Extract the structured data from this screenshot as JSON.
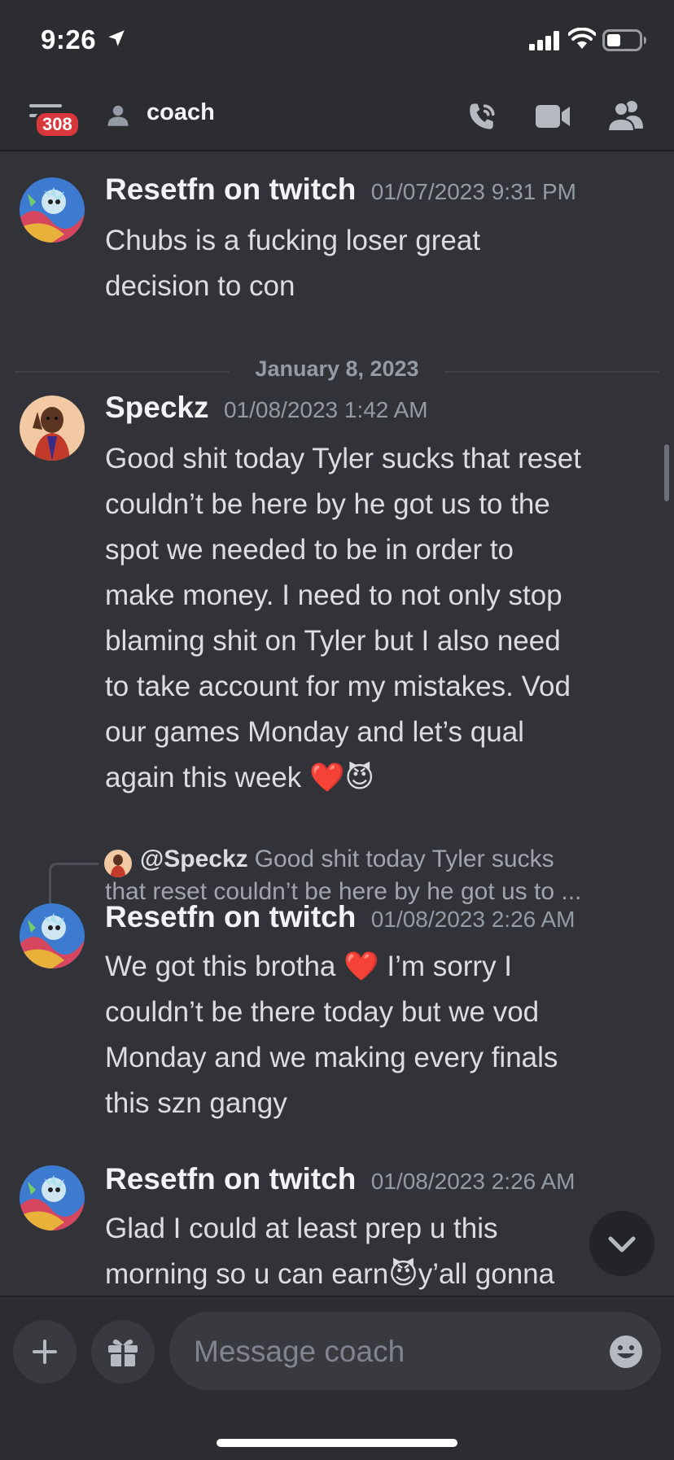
{
  "status": {
    "time": "9:26"
  },
  "header": {
    "badge": "308",
    "title": "coach"
  },
  "divider": {
    "label": "January 8, 2023"
  },
  "messages": [
    {
      "author": "Resetfn on twitch",
      "timestamp": "01/07/2023 9:31 PM",
      "lines": [
        "Chubs is a fucking loser great",
        "decision to con"
      ]
    },
    {
      "author": "Speckz",
      "timestamp": "01/08/2023 1:42 AM",
      "lines": [
        "Good shit today Tyler sucks that reset",
        "couldn’t be here by he got us to the",
        "spot we needed to be in order to",
        "make money. I need to not only stop",
        "blaming shit on Tyler but I also need",
        "to take account for my mistakes. Vod",
        "our games Monday and let’s qual",
        "again this week ❤️😈"
      ]
    },
    {
      "author": "Resetfn on twitch",
      "timestamp": "01/08/2023 2:26 AM",
      "lines": [
        "We got this brotha ❤️ I’m sorry I",
        "couldn’t be there today but we vod",
        "Monday and we making every finals",
        "this szn gangy"
      ]
    },
    {
      "author": "Resetfn on twitch",
      "timestamp": "01/08/2023 2:26 AM",
      "lines": [
        "Glad I could at least prep u this",
        "morning so u can earn😈y’all gonna"
      ]
    }
  ],
  "reply": {
    "name": "@Speckz",
    "line1": "Good shit today Tyler sucks",
    "line2": "that reset couldn’t be here by he got us to ..."
  },
  "composer": {
    "placeholder": "Message coach"
  }
}
